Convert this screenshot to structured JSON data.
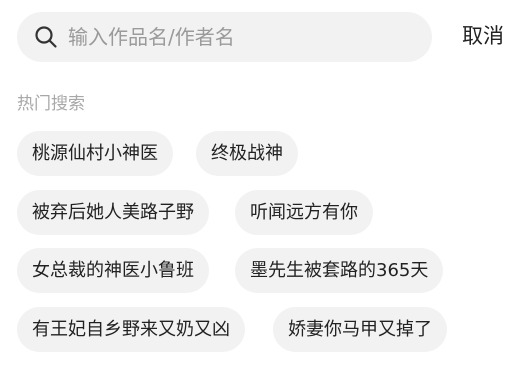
{
  "search": {
    "icon": "search-icon",
    "placeholder": "输入作品名/作者名",
    "value": ""
  },
  "cancel_label": "取消",
  "hot_search": {
    "title": "热门搜索",
    "tags": [
      "桃源仙村小神医",
      "终极战神",
      "被弃后她人美路子野",
      "听闻远方有你",
      "女总裁的神医小鲁班",
      "墨先生被套路的365天",
      "有王妃自乡野来又奶又凶",
      "娇妻你马甲又掉了"
    ]
  },
  "colors": {
    "background": "#ffffff",
    "chip_background": "#f2f2f2",
    "placeholder": "#9a9a9a",
    "section_title": "#a8a8a8",
    "text": "#222222"
  }
}
